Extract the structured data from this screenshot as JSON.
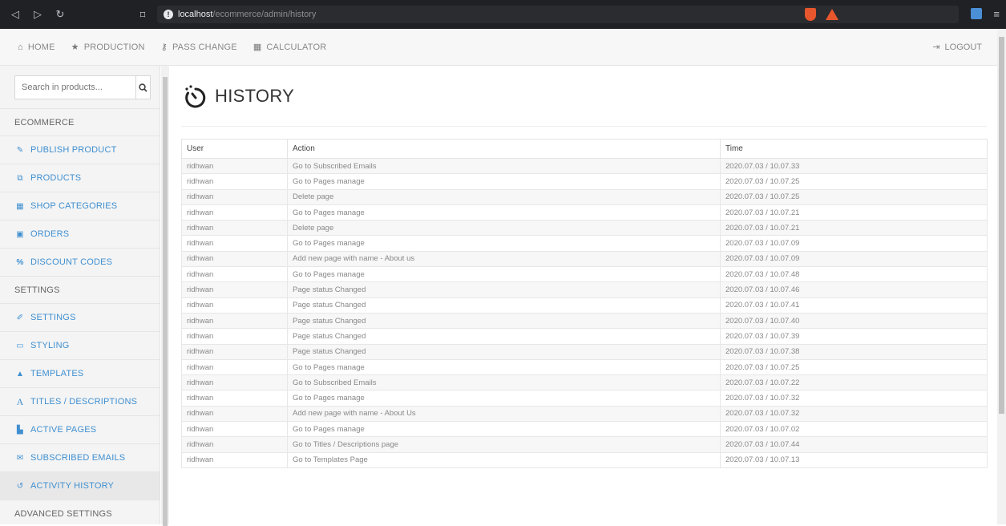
{
  "browser": {
    "url_host": "localhost",
    "url_path": "/ecommerce/admin/history"
  },
  "topnav": {
    "items": [
      {
        "label": "HOME",
        "icon": "home-icon",
        "glyph": "🏠"
      },
      {
        "label": "PRODUCTION",
        "icon": "star-icon",
        "glyph": "★"
      },
      {
        "label": "PASS CHANGE",
        "icon": "key-icon",
        "glyph": "⚷"
      },
      {
        "label": "CALCULATOR",
        "icon": "calculator-icon",
        "glyph": "▦"
      }
    ],
    "logout": "LOGOUT"
  },
  "sidebar": {
    "search_placeholder": "Search in products...",
    "sections": [
      {
        "title": "ECOMMERCE",
        "links": [
          {
            "label": "PUBLISH PRODUCT",
            "icon": "edit-icon",
            "glyph": "✎"
          },
          {
            "label": "PRODUCTS",
            "icon": "products-icon",
            "glyph": "⧉"
          },
          {
            "label": "SHOP CATEGORIES",
            "icon": "table-icon",
            "glyph": "▦"
          },
          {
            "label": "ORDERS",
            "icon": "money-icon",
            "glyph": "▣"
          },
          {
            "label": "DISCOUNT CODES",
            "icon": "percent-icon",
            "glyph": "%"
          }
        ]
      },
      {
        "title": "SETTINGS",
        "links": [
          {
            "label": "SETTINGS",
            "icon": "wrench-icon",
            "glyph": "✐"
          },
          {
            "label": "STYLING",
            "icon": "monitor-icon",
            "glyph": "▭"
          },
          {
            "label": "TEMPLATES",
            "icon": "binoculars-icon",
            "glyph": "▲"
          },
          {
            "label": "TITLES / DESCRIPTIONS",
            "icon": "font-icon",
            "glyph": "A"
          },
          {
            "label": "ACTIVE PAGES",
            "icon": "file-icon",
            "glyph": "▙"
          },
          {
            "label": "SUBSCRIBED EMAILS",
            "icon": "envelope-icon",
            "glyph": "✉"
          },
          {
            "label": "ACTIVITY HISTORY",
            "icon": "history-icon",
            "glyph": "↺",
            "active": true
          }
        ]
      },
      {
        "title": "ADVANCED SETTINGS",
        "links": []
      }
    ]
  },
  "main": {
    "title": "HISTORY",
    "columns": [
      "User",
      "Action",
      "Time"
    ],
    "rows": [
      [
        "ridhwan",
        "Go to Subscribed Emails",
        "2020.07.03 / 10.07.33"
      ],
      [
        "ridhwan",
        "Go to Pages manage",
        "2020.07.03 / 10.07.25"
      ],
      [
        "ridhwan",
        "Delete page",
        "2020.07.03 / 10.07.25"
      ],
      [
        "ridhwan",
        "Go to Pages manage",
        "2020.07.03 / 10.07.21"
      ],
      [
        "ridhwan",
        "Delete page",
        "2020.07.03 / 10.07.21"
      ],
      [
        "ridhwan",
        "Go to Pages manage",
        "2020.07.03 / 10.07.09"
      ],
      [
        "ridhwan",
        "Add new page with name - About us",
        "2020.07.03 / 10.07.09"
      ],
      [
        "ridhwan",
        "Go to Pages manage",
        "2020.07.03 / 10.07.48"
      ],
      [
        "ridhwan",
        "Page status Changed",
        "2020.07.03 / 10.07.46"
      ],
      [
        "ridhwan",
        "Page status Changed",
        "2020.07.03 / 10.07.41"
      ],
      [
        "ridhwan",
        "Page status Changed",
        "2020.07.03 / 10.07.40"
      ],
      [
        "ridhwan",
        "Page status Changed",
        "2020.07.03 / 10.07.39"
      ],
      [
        "ridhwan",
        "Page status Changed",
        "2020.07.03 / 10.07.38"
      ],
      [
        "ridhwan",
        "Go to Pages manage",
        "2020.07.03 / 10.07.25"
      ],
      [
        "ridhwan",
        "Go to Subscribed Emails",
        "2020.07.03 / 10.07.22"
      ],
      [
        "ridhwan",
        "Go to Pages manage",
        "2020.07.03 / 10.07.32"
      ],
      [
        "ridhwan",
        "Add new page with name - About Us",
        "2020.07.03 / 10.07.32"
      ],
      [
        "ridhwan",
        "Go to Pages manage",
        "2020.07.03 / 10.07.02"
      ],
      [
        "ridhwan",
        "Go to Titles / Descriptions page",
        "2020.07.03 / 10.07.44"
      ],
      [
        "ridhwan",
        "Go to Templates Page",
        "2020.07.03 / 10.07.13"
      ]
    ]
  },
  "colors": {
    "accent": "#3f8fd0",
    "chrome": "#202124"
  }
}
